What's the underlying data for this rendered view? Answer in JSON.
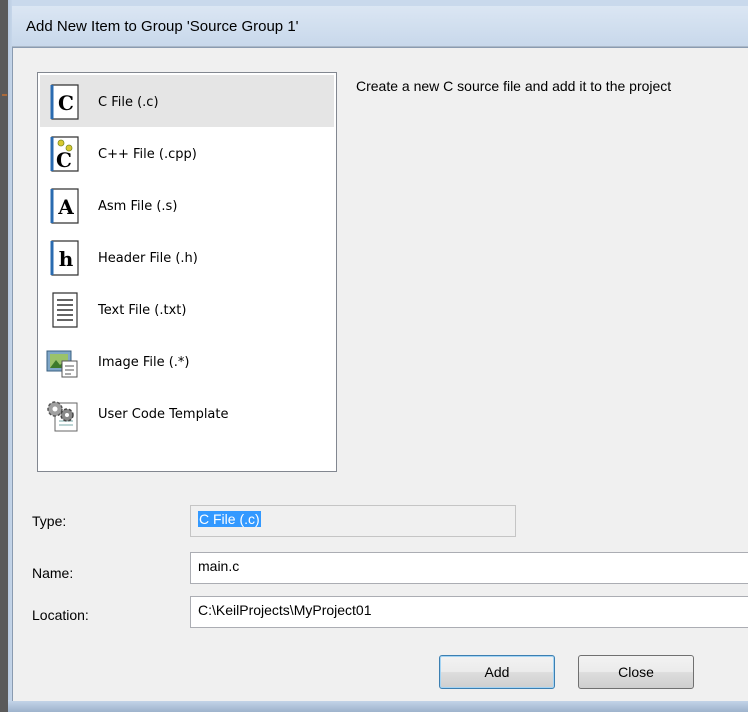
{
  "window": {
    "title": "Add New Item to Group 'Source Group 1'"
  },
  "item_list": {
    "selected_index": 0,
    "items": [
      {
        "label": "C File (.c)",
        "icon": "c-file-icon"
      },
      {
        "label": "C++ File (.cpp)",
        "icon": "cpp-file-icon"
      },
      {
        "label": "Asm File (.s)",
        "icon": "asm-file-icon"
      },
      {
        "label": "Header File (.h)",
        "icon": "header-file-icon"
      },
      {
        "label": "Text File (.txt)",
        "icon": "text-file-icon"
      },
      {
        "label": "Image File (.*)",
        "icon": "image-file-icon"
      },
      {
        "label": "User Code Template",
        "icon": "user-code-template-icon"
      }
    ]
  },
  "description": "Create a new C source file and add it to the project",
  "form": {
    "type_label": "Type:",
    "type_value": "C File (.c)",
    "name_label": "Name:",
    "name_value": "main.c",
    "location_label": "Location:",
    "location_value": "C:\\KeilProjects\\MyProject01"
  },
  "buttons": {
    "add_label": "Add",
    "close_label": "Close"
  },
  "colors": {
    "selection_highlight": "#3399ff",
    "list_selected_bg": "#e5e5e5"
  }
}
